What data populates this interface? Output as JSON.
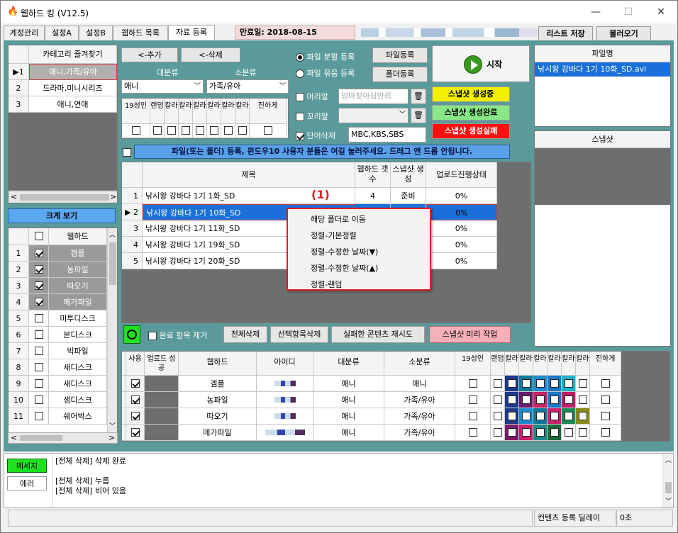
{
  "window": {
    "title": "웹하드 킹 (V12.5)",
    "minimize": "—",
    "maximize": "☐",
    "close": "✕"
  },
  "tabs": [
    {
      "label": "계정관리"
    },
    {
      "label": "설정A"
    },
    {
      "label": "설정B"
    },
    {
      "label": "웹하드 목록"
    },
    {
      "label": "자료 등록",
      "active": true
    }
  ],
  "expiry": "만료일: 2018-08-15 00:00:00",
  "top_buttons": {
    "save_list": "리스트 저장",
    "load": "불러오기"
  },
  "category": {
    "header": "카테고리 즐겨찾기",
    "rows": [
      {
        "n": "1",
        "v": "애니,가족/유아"
      },
      {
        "n": "2",
        "v": "드라마,미니시리즈"
      },
      {
        "n": "3",
        "v": "애니,연애"
      }
    ],
    "arrow_left": "<",
    "arrow_right": ">"
  },
  "big_view": "크게 보기",
  "webhard_list": {
    "header": "웹하드",
    "rows": [
      {
        "n": "1",
        "v": "겜플",
        "on": true
      },
      {
        "n": "2",
        "v": "농파일",
        "on": true
      },
      {
        "n": "3",
        "v": "따오기",
        "on": true
      },
      {
        "n": "4",
        "v": "메가파일",
        "on": true
      },
      {
        "n": "5",
        "v": "미투디스크",
        "on": false
      },
      {
        "n": "6",
        "v": "본디스크",
        "on": false
      },
      {
        "n": "7",
        "v": "빅파일",
        "on": false
      },
      {
        "n": "8",
        "v": "새디스크",
        "on": false
      },
      {
        "n": "9",
        "v": "새디스크",
        "on": false
      },
      {
        "n": "10",
        "v": "샘디스크",
        "on": false
      },
      {
        "n": "11",
        "v": "쉐어박스",
        "on": false
      }
    ]
  },
  "controls": {
    "add": "<-추가",
    "delete": "<-삭제",
    "major_label": "대분류",
    "minor_label": "소분류",
    "major_value": "애니",
    "minor_value": "가족/유아",
    "flags": [
      "19성인",
      "랜덤",
      "칼라",
      "칼라",
      "칼라",
      "칼라",
      "칼라",
      "칼라",
      "진하게"
    ],
    "radio_split": "파일 분할 등록",
    "radio_bundle": "파일 묶음 등록",
    "file_reg": "파일등록",
    "folder_reg": "폴더등록",
    "start": "시작",
    "header_label": "머리말",
    "header_placeholder": "엄마찾아삼만리",
    "footer_label": "꼬리말",
    "word_delete_label": "단어삭제",
    "word_delete_value": "MBC,KBS,SBS",
    "snap_generating": "스냅샷 생성중",
    "snap_done": "스냅샷 생성완료",
    "snap_failed": "스냅샷 생성실패",
    "notice": "파일(또는 폴더) 등록, 윈도우10 사용자 분들은 여길 눌러주세요. 드레그 앤 드롭 안됩니다.",
    "trash": "🗑"
  },
  "file_table": {
    "headers": [
      "제목",
      "웹하드 갯수",
      "스냅샷 생성",
      "업로드진행상태"
    ],
    "rows": [
      {
        "n": "1",
        "title": "낚시왕 강바다 1기 1화_SD",
        "count": "4",
        "snap": "준비",
        "progress": "0%"
      },
      {
        "n": "2",
        "title": "낚시왕 강바다 1기 10화_SD",
        "count": "",
        "snap": "준비",
        "progress": "0%",
        "selected": true
      },
      {
        "n": "3",
        "title": "낚시왕 강바다 1기 11화_SD",
        "count": "",
        "snap": "",
        "progress": "0%"
      },
      {
        "n": "4",
        "title": "낚시왕 강바다 1기 19화_SD",
        "count": "",
        "snap": "",
        "progress": "0%"
      },
      {
        "n": "5",
        "title": "낚시왕 강바다 1기 20화_SD",
        "count": "",
        "snap": "",
        "progress": "0%"
      }
    ]
  },
  "annotation": "(1)",
  "context_menu": [
    "해당 폴더로 이동",
    "정렬-기본정렬",
    "정렬-수정한 날짜(▼)",
    "정렬-수정한 날짜(▲)",
    "정렬-랜덤"
  ],
  "action_bar": {
    "remove_done": "완료 항목 제거",
    "delete_all": "전체삭제",
    "delete_selected": "선택항목삭제",
    "retry_failed": "실패한 콘텐츠 재시도",
    "preview": "스냅샷 미리 작업"
  },
  "filename_panel": {
    "header": "파일명",
    "item": "낚시왕 강바다 1기 10화_SD.avi"
  },
  "snapshot_panel": {
    "header": "스냅샷"
  },
  "upload_table": {
    "headers": [
      "사용",
      "업로드 성공",
      "웹하드",
      "아이디",
      "대분류",
      "소분류",
      "19성인",
      "랜덤",
      "칼라",
      "칼라",
      "칼라",
      "칼라",
      "칼라",
      "칼라",
      "진하게"
    ],
    "rows": [
      {
        "n": "1",
        "name": "겜플",
        "major": "애니",
        "minor": "애니",
        "colors": [
          "#1a3a8a",
          "#0b7a9a",
          "#1a8ad0",
          "#1a78c8",
          "#1ab0c8",
          "#fff"
        ]
      },
      {
        "n": "2",
        "name": "농파일",
        "major": "애니",
        "minor": "가족/유아",
        "colors": [
          "#1a3a8a",
          "#6a1a6a",
          "#c8206a",
          "#1a78c8",
          "#c01a6a",
          "#fff"
        ]
      },
      {
        "n": "3",
        "name": "따오기",
        "major": "애니",
        "minor": "가족/유아",
        "colors": [
          "#1a3a8a",
          "#1a8ad0",
          "#0b7a9a",
          "#c8206a",
          "#1a8a5a",
          "#8a8a1a"
        ]
      },
      {
        "n": "4",
        "name": "메가파일",
        "major": "애니",
        "minor": "가족/유아",
        "colors": [
          "#7a1a6a",
          "#c8206a",
          "#1a8a8a",
          "#1a6a3a",
          "#fff",
          "#fff"
        ]
      }
    ]
  },
  "messages": {
    "tab_message": "메세지",
    "tab_error": "에러",
    "lines": [
      "[전체 삭제] 삭제 완료",
      "",
      "[전체 삭제] 누름",
      "[전체 삭제] 비어 있음"
    ]
  },
  "status": {
    "delay_label": "컨텐츠 등록 딜레이",
    "delay_value": "0초"
  }
}
